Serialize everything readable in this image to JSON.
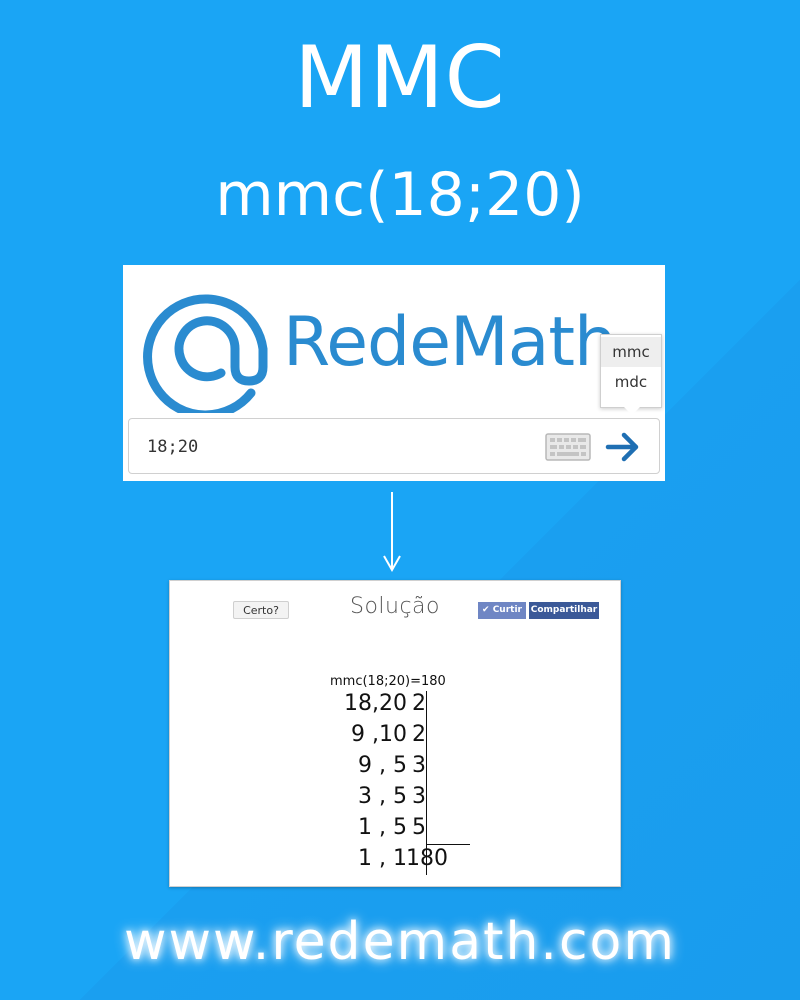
{
  "header": {
    "title": "MMC",
    "subtitle": "mmc(18;20)"
  },
  "app": {
    "logo_text": "RedeMath",
    "dropdown_options": [
      "mmc",
      "mdc"
    ],
    "selected_option": "mmc",
    "search_value": "18;20",
    "icons": {
      "logo": "at-sign-logo-icon",
      "keyboard": "keyboard-icon",
      "go": "arrow-right-icon"
    },
    "accent_color": "#2a8bd0"
  },
  "solution": {
    "certo_label": "Certo?",
    "title": "Solução",
    "curtir_label": "Curtir",
    "compartilhar_label": "Compartilhar",
    "result": "mmc(18;20)=180",
    "rows": [
      {
        "left": "18,20",
        "right": "2"
      },
      {
        "left": "9 ,10",
        "right": "2"
      },
      {
        "left": "9 , 5",
        "right": "3"
      },
      {
        "left": "3 , 5",
        "right": "3"
      },
      {
        "left": "1 , 5",
        "right": "5"
      },
      {
        "left": "1 , 1",
        "right": "180"
      }
    ]
  },
  "footer": {
    "url": "www.redemath.com"
  },
  "colors": {
    "background": "#1aa5f5",
    "facebook": "#3b5998"
  }
}
